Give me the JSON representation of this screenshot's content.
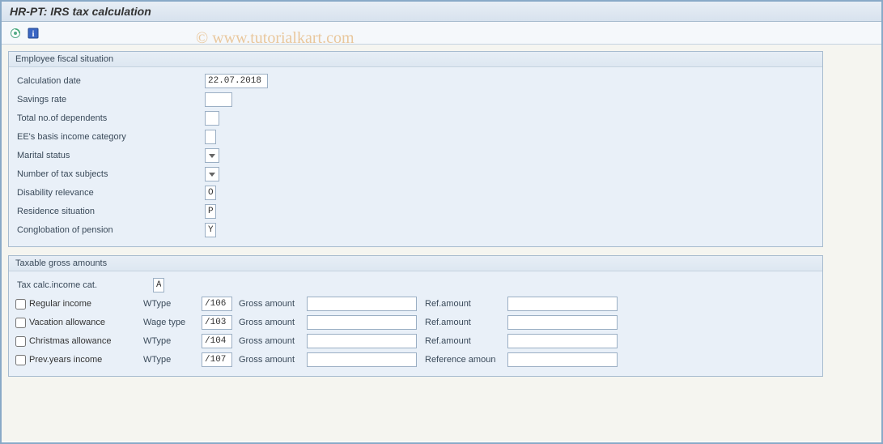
{
  "title": "HR-PT: IRS tax calculation",
  "watermark": "© www.tutorialkart.com",
  "toolbar": {
    "execute_icon": "execute-icon",
    "info_icon": "info-icon"
  },
  "group1": {
    "title": "Employee fiscal situation",
    "calc_date_label": "Calculation date",
    "calc_date_value": "22.07.2018",
    "savings_label": "Savings rate",
    "savings_value": "",
    "dependents_label": "Total no.of dependents",
    "dependents_value": "",
    "ee_basis_label": "EE's basis income category",
    "ee_basis_value": "",
    "marital_label": "Marital status",
    "tax_subjects_label": "Number of tax subjects",
    "disability_label": "Disability relevance",
    "disability_value": "O",
    "residence_label": "Residence situation",
    "residence_value": "P",
    "conglobation_label": "Conglobation of pension",
    "conglobation_value": "Y"
  },
  "group2": {
    "title": "Taxable gross amounts",
    "tax_cat_label": "Tax calc.income cat.",
    "tax_cat_value": "A",
    "rows": [
      {
        "check_label": "Regular income",
        "wtype_label": "WType",
        "wtype_value": "/106",
        "gross_label": "Gross amount",
        "gross_value": "",
        "ref_label": "Ref.amount",
        "ref_value": ""
      },
      {
        "check_label": "Vacation allowance",
        "wtype_label": "Wage type",
        "wtype_value": "/103",
        "gross_label": "Gross amount",
        "gross_value": "",
        "ref_label": "Ref.amount",
        "ref_value": ""
      },
      {
        "check_label": "Christmas allowance",
        "wtype_label": "WType",
        "wtype_value": "/104",
        "gross_label": "Gross amount",
        "gross_value": "",
        "ref_label": "Ref.amount",
        "ref_value": ""
      },
      {
        "check_label": "Prev.years income",
        "wtype_label": "WType",
        "wtype_value": "/107",
        "gross_label": "Gross amount",
        "gross_value": "",
        "ref_label": "Reference amoun",
        "ref_value": ""
      }
    ]
  }
}
